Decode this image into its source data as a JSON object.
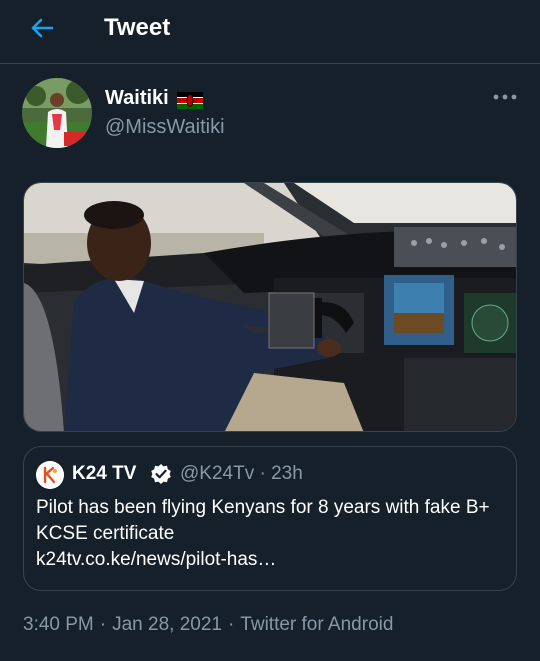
{
  "header": {
    "title": "Tweet",
    "back_icon": "arrow-left-icon",
    "accent_color": "#1da1f2"
  },
  "tweet": {
    "author": {
      "display_name": "Waitiki",
      "flag_icon": "kenya-flag-icon",
      "handle": "@MissWaitiki"
    },
    "more_icon": "more-horizontal-icon",
    "media": {
      "kind": "photo"
    },
    "quoted": {
      "name": "K24 TV",
      "verified_icon": "verified-badge-icon",
      "handle": "@K24Tv",
      "separator": "·",
      "time": "23h",
      "text": "Pilot has been flying Kenyans for 8 years with fake B+ KCSE certificate",
      "link": "k24tv.co.ke/news/pilot-has…"
    },
    "time": "3:40 PM",
    "date": "Jan 28, 2021",
    "source": "Twitter for Android",
    "separator": "·"
  },
  "colors": {
    "background": "#15202b",
    "border": "#38444d",
    "secondary_text": "#8899a6",
    "verified": "#1da1f2"
  }
}
